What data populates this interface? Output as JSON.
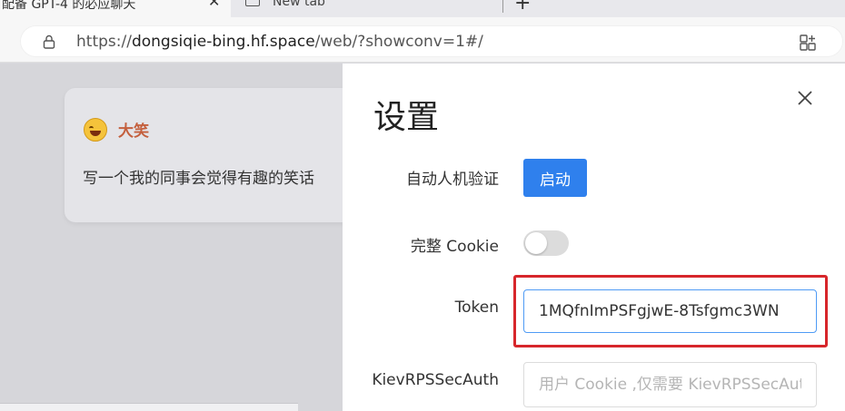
{
  "browser": {
    "tabs": [
      {
        "title": "配备 GPT-4 的必应聊天",
        "close": "✕"
      },
      {
        "title": "New tab",
        "close": "✕"
      }
    ],
    "new_tab": "+",
    "url": {
      "prefix": "https://",
      "host": "dongsiqie-bing.hf.space",
      "path": "/web/?showconv=1#/"
    },
    "icons": {
      "lock": "lock-icon",
      "collections": "collections-icon",
      "favicon": "newtab-icon"
    }
  },
  "background": {
    "card": {
      "emoji": "grinning-face-icon",
      "title": "大笑",
      "text": "写一个我的同事会觉得有趣的笑话"
    }
  },
  "settings": {
    "title": "设置",
    "close_icon": "close-icon",
    "rows": {
      "captcha": {
        "label": "自动人机验证",
        "button": "启动"
      },
      "cookie": {
        "label": "完整 Cookie",
        "enabled": false
      },
      "token": {
        "label": "Token",
        "value": "1MQfnImPSFgjwE-8Tsfgmc3WN"
      },
      "kiev": {
        "label": "KievRPSSecAuth",
        "placeholder": "用户 Cookie ,仅需要 KievRPSSecAuth"
      }
    }
  },
  "colors": {
    "primary": "#2f80ed",
    "highlight": "#d7262b",
    "accent_title": "#c4603e"
  }
}
